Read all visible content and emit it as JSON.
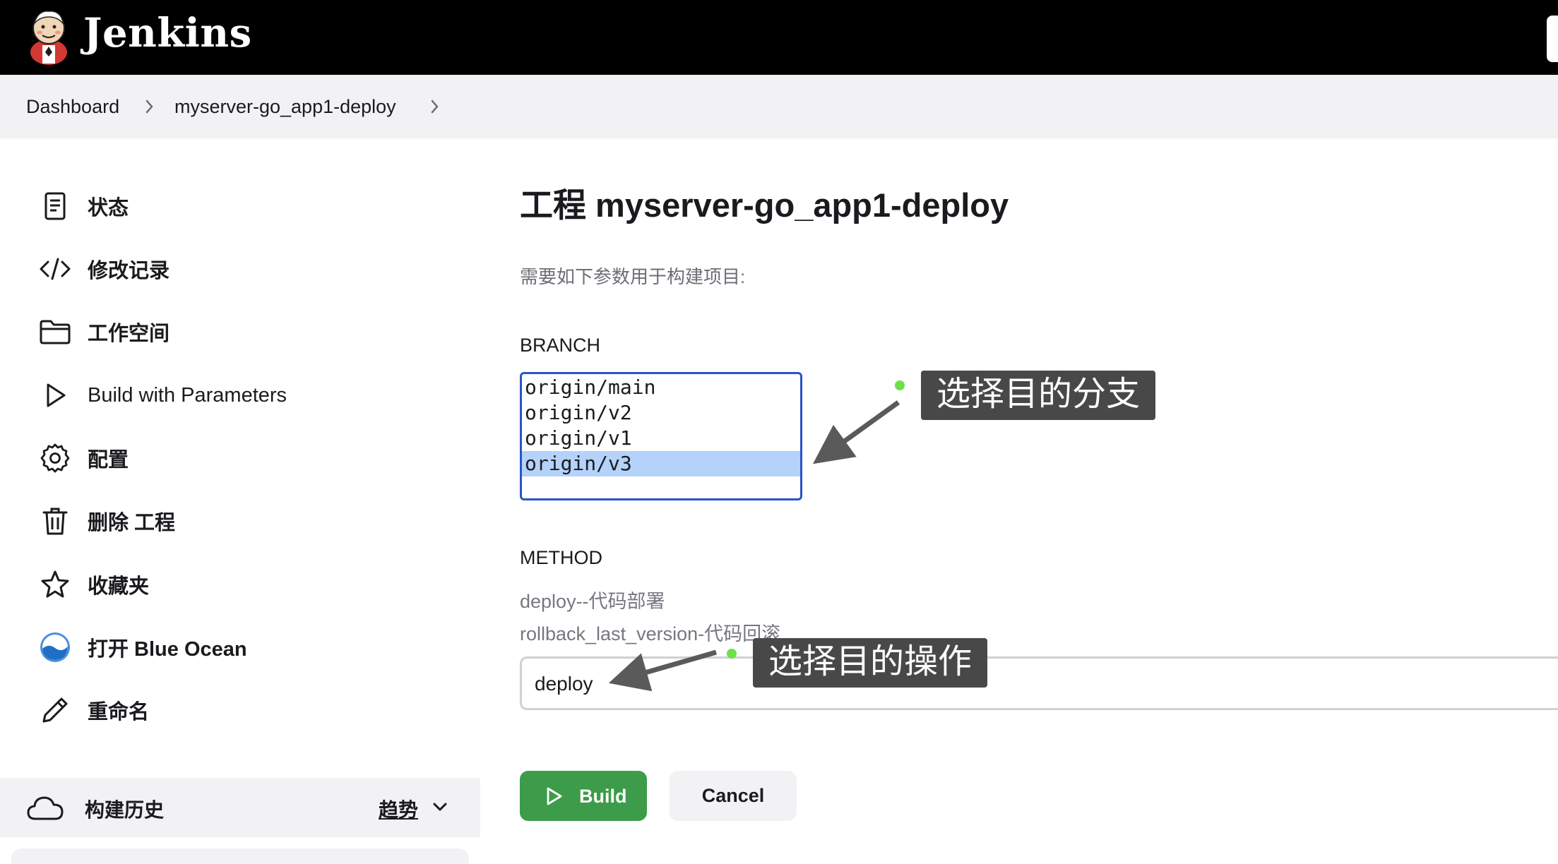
{
  "header": {
    "brand": "Jenkins"
  },
  "breadcrumb": {
    "items": [
      "Dashboard",
      "myserver-go_app1-deploy"
    ]
  },
  "sidebar": {
    "items": [
      {
        "label": "状态",
        "icon": "document-icon"
      },
      {
        "label": "修改记录",
        "icon": "code-icon"
      },
      {
        "label": "工作空间",
        "icon": "folder-icon"
      },
      {
        "label": "Build with Parameters",
        "icon": "play-icon"
      },
      {
        "label": "配置",
        "icon": "gear-icon"
      },
      {
        "label": "删除 工程",
        "icon": "trash-icon"
      },
      {
        "label": "收藏夹",
        "icon": "star-icon"
      },
      {
        "label": "打开 Blue Ocean",
        "icon": "blue-ocean-icon"
      },
      {
        "label": "重命名",
        "icon": "pencil-icon"
      }
    ],
    "history": {
      "title": "构建历史",
      "trend": "趋势"
    }
  },
  "main": {
    "title": "工程 myserver-go_app1-deploy",
    "description": "需要如下参数用于构建项目:",
    "branch": {
      "label": "BRANCH",
      "options": [
        "origin/main",
        "origin/v2",
        "origin/v1",
        "origin/v3"
      ],
      "selected": "origin/v3"
    },
    "method": {
      "label": "METHOD",
      "descriptions": [
        "deploy--代码部署",
        "rollback_last_version-代码回滚"
      ],
      "value": "deploy"
    },
    "buttons": {
      "build": "Build",
      "cancel": "Cancel"
    }
  },
  "annotations": {
    "branch_callout": "选择目的分支",
    "method_callout": "选择目的操作"
  },
  "colors": {
    "header_bg": "#000000",
    "build_button": "#3c9c4a",
    "selected_option": "#b4d2fa",
    "listbox_border": "#2a55c5",
    "callout_bg": "#484848",
    "callout_dot": "#6ee04a"
  }
}
